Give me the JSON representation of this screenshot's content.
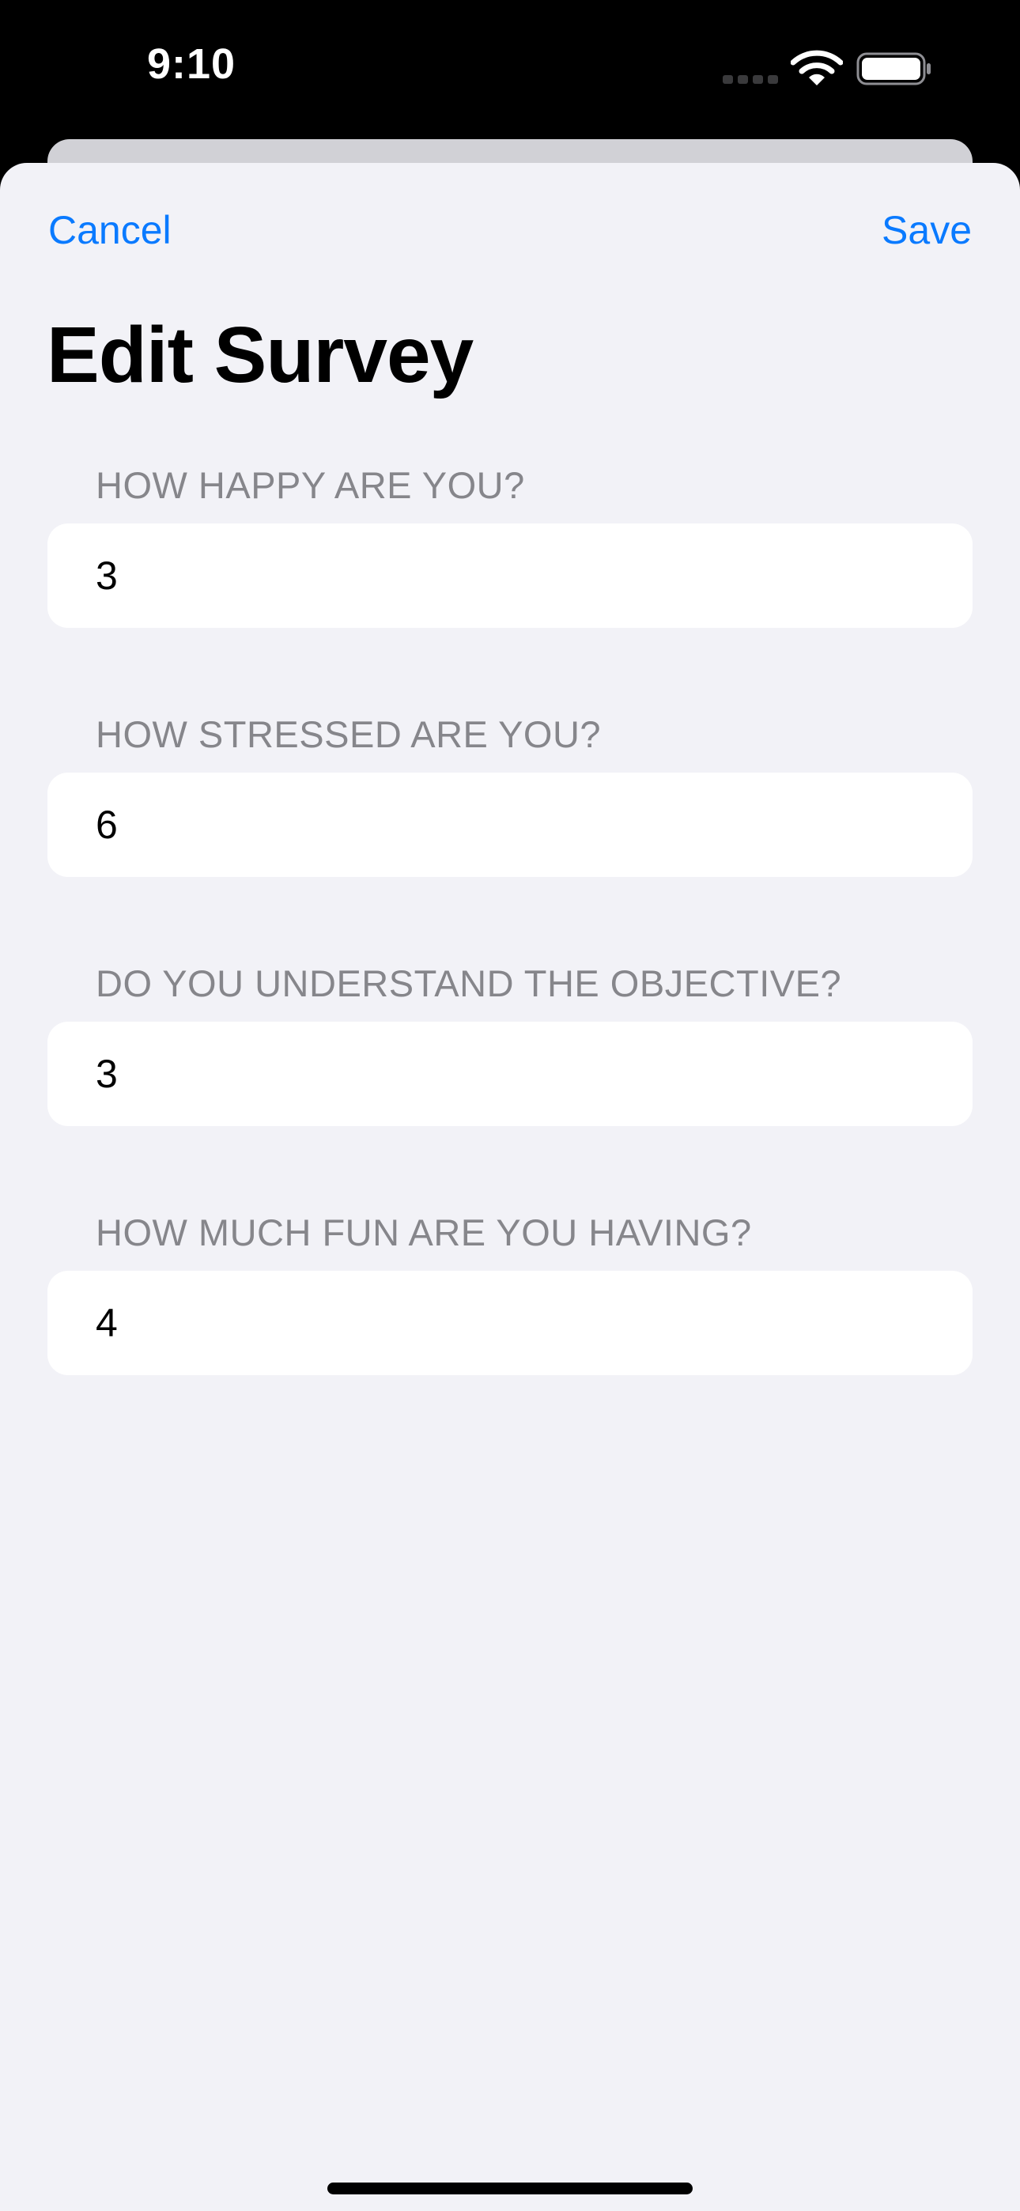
{
  "status_bar": {
    "time": "9:10",
    "icons": [
      "cellular-icon",
      "wifi-icon",
      "battery-icon"
    ]
  },
  "nav": {
    "cancel_label": "Cancel",
    "save_label": "Save",
    "accent_color": "#0A7AFF"
  },
  "page": {
    "title": "Edit Survey"
  },
  "sections": [
    {
      "header": "HOW HAPPY ARE YOU?",
      "value": "3"
    },
    {
      "header": "HOW STRESSED ARE YOU?",
      "value": "6"
    },
    {
      "header": "DO YOU UNDERSTAND THE OBJECTIVE?",
      "value": "3"
    },
    {
      "header": "HOW MUCH FUN ARE YOU HAVING?",
      "value": "4"
    }
  ],
  "colors": {
    "background": "#F2F2F7",
    "field_background": "#FFFFFF",
    "header_text": "#86868B"
  }
}
